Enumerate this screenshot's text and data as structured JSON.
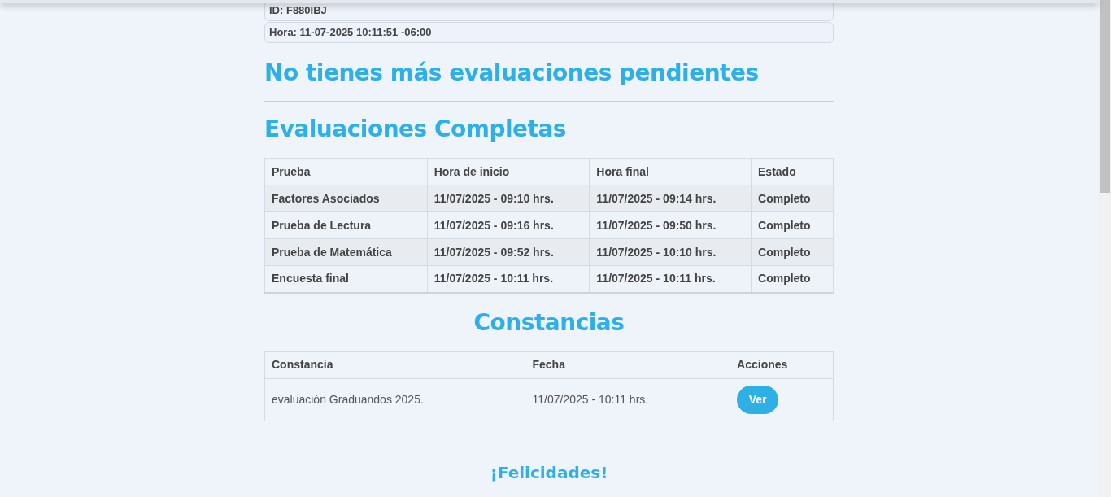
{
  "info": [
    "ID: F880IBJ",
    "Hora: 11-07-2025 10:11:51 -06:00"
  ],
  "pending_title": "No tienes más evaluaciones pendientes",
  "completed": {
    "title": "Evaluaciones Completas",
    "columns": [
      "Prueba",
      "Hora de inicio",
      "Hora final",
      "Estado"
    ],
    "rows": [
      [
        "Factores Asociados",
        "11/07/2025 - 09:10 hrs.",
        "11/07/2025 - 09:14 hrs.",
        "Completo"
      ],
      [
        "Prueba de Lectura",
        "11/07/2025 - 09:16 hrs.",
        "11/07/2025 - 09:50 hrs.",
        "Completo"
      ],
      [
        "Prueba de Matemática",
        "11/07/2025 - 09:52 hrs.",
        "11/07/2025 - 10:10 hrs.",
        "Completo"
      ],
      [
        "Encuesta final",
        "11/07/2025 - 10:11 hrs.",
        "11/07/2025 - 10:11 hrs.",
        "Completo"
      ]
    ]
  },
  "certificates": {
    "title": "Constancias",
    "columns": [
      "Constancia",
      "Fecha",
      "Acciones"
    ],
    "rows": [
      {
        "name": "evaluación Graduandos 2025.",
        "date": "11/07/2025 - 10:11 hrs.",
        "action": "Ver"
      }
    ]
  },
  "closing": "¡Felicidades!"
}
